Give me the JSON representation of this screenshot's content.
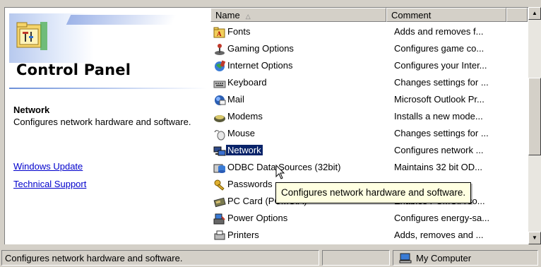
{
  "left_pane": {
    "title": "Control Panel",
    "info_title": "Network",
    "info_description": "Configures network hardware and software.",
    "links": [
      "Windows Update",
      "Technical Support"
    ]
  },
  "list": {
    "columns": {
      "name": "Name",
      "comment": "Comment"
    },
    "items": [
      {
        "name": "Fonts",
        "comment": "Adds and removes f...",
        "icon": "fonts-folder-icon"
      },
      {
        "name": "Gaming Options",
        "comment": "Configures game co...",
        "icon": "joystick-icon"
      },
      {
        "name": "Internet Options",
        "comment": "Configures your Inter...",
        "icon": "internet-globe-icon"
      },
      {
        "name": "Keyboard",
        "comment": "Changes settings for ...",
        "icon": "keyboard-icon"
      },
      {
        "name": "Mail",
        "comment": "Microsoft Outlook Pr...",
        "icon": "mail-icon"
      },
      {
        "name": "Modems",
        "comment": "Installs a new mode...",
        "icon": "modem-icon"
      },
      {
        "name": "Mouse",
        "comment": "Changes settings for ...",
        "icon": "mouse-icon"
      },
      {
        "name": "Network",
        "comment": "Configures network ...",
        "icon": "network-icon",
        "selected": true
      },
      {
        "name": "ODBC Data Sources (32bit)",
        "comment": "Maintains 32 bit OD...",
        "icon": "odbc-icon"
      },
      {
        "name": "Passwords",
        "comment": "",
        "icon": "passwords-key-icon"
      },
      {
        "name": "PC Card (PCMCIA)",
        "comment": "Enables PCMCIA so...",
        "icon": "pc-card-icon"
      },
      {
        "name": "Power Options",
        "comment": "Configures energy-sa...",
        "icon": "power-options-icon"
      },
      {
        "name": "Printers",
        "comment": "Adds, removes and ...",
        "icon": "printers-icon"
      }
    ]
  },
  "tooltip": "Configures network hardware and software.",
  "statusbar": {
    "text": "Configures network hardware and software.",
    "zone": "My Computer"
  },
  "colors": {
    "selection": "#0a246a",
    "link": "#0000cc",
    "tooltip_bg": "#ffffe1",
    "chrome": "#d4d0c8"
  }
}
